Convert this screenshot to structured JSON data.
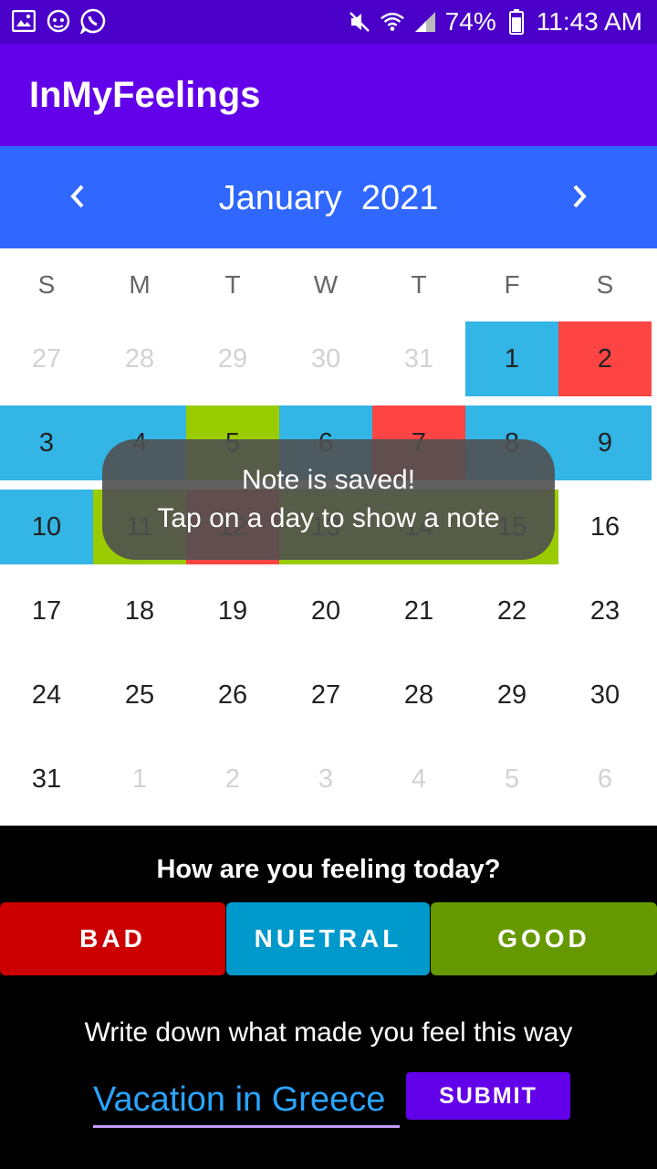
{
  "status_bar": {
    "battery": "74%",
    "time": "11:43 AM",
    "icons": [
      "image-icon",
      "face-icon",
      "whatsapp-icon",
      "mute-icon",
      "wifi-icon",
      "signal-icon",
      "battery-icon"
    ]
  },
  "app": {
    "title": "InMyFeelings"
  },
  "calendar": {
    "month": "January",
    "year": "2021",
    "prev_icon": "chevron-left-icon",
    "next_icon": "chevron-right-icon",
    "weekdays": [
      "S",
      "M",
      "T",
      "W",
      "T",
      "F",
      "S"
    ],
    "days": [
      {
        "n": "27",
        "faded": true,
        "mood": null
      },
      {
        "n": "28",
        "faded": true,
        "mood": null
      },
      {
        "n": "29",
        "faded": true,
        "mood": null
      },
      {
        "n": "30",
        "faded": true,
        "mood": null
      },
      {
        "n": "31",
        "faded": true,
        "mood": null
      },
      {
        "n": "1",
        "faded": false,
        "mood": "neutral"
      },
      {
        "n": "2",
        "faded": false,
        "mood": "bad"
      },
      {
        "n": "3",
        "faded": false,
        "mood": "neutral"
      },
      {
        "n": "4",
        "faded": false,
        "mood": "neutral"
      },
      {
        "n": "5",
        "faded": false,
        "mood": "good"
      },
      {
        "n": "6",
        "faded": false,
        "mood": "neutral"
      },
      {
        "n": "7",
        "faded": false,
        "mood": "bad"
      },
      {
        "n": "8",
        "faded": false,
        "mood": "neutral"
      },
      {
        "n": "9",
        "faded": false,
        "mood": "neutral"
      },
      {
        "n": "10",
        "faded": false,
        "mood": "neutral"
      },
      {
        "n": "11",
        "faded": false,
        "mood": "good"
      },
      {
        "n": "12",
        "faded": false,
        "mood": "bad"
      },
      {
        "n": "13",
        "faded": false,
        "mood": "good"
      },
      {
        "n": "14",
        "faded": false,
        "mood": "good"
      },
      {
        "n": "15",
        "faded": false,
        "mood": "good"
      },
      {
        "n": "16",
        "faded": false,
        "mood": null
      },
      {
        "n": "17",
        "faded": false,
        "mood": null
      },
      {
        "n": "18",
        "faded": false,
        "mood": null
      },
      {
        "n": "19",
        "faded": false,
        "mood": null
      },
      {
        "n": "20",
        "faded": false,
        "mood": null
      },
      {
        "n": "21",
        "faded": false,
        "mood": null
      },
      {
        "n": "22",
        "faded": false,
        "mood": null
      },
      {
        "n": "23",
        "faded": false,
        "mood": null
      },
      {
        "n": "24",
        "faded": false,
        "mood": null
      },
      {
        "n": "25",
        "faded": false,
        "mood": null
      },
      {
        "n": "26",
        "faded": false,
        "mood": null
      },
      {
        "n": "27",
        "faded": false,
        "mood": null
      },
      {
        "n": "28",
        "faded": false,
        "mood": null
      },
      {
        "n": "29",
        "faded": false,
        "mood": null
      },
      {
        "n": "30",
        "faded": false,
        "mood": null
      },
      {
        "n": "31",
        "faded": false,
        "mood": null
      },
      {
        "n": "1",
        "faded": true,
        "mood": null
      },
      {
        "n": "2",
        "faded": true,
        "mood": null
      },
      {
        "n": "3",
        "faded": true,
        "mood": null
      },
      {
        "n": "4",
        "faded": true,
        "mood": null
      },
      {
        "n": "5",
        "faded": true,
        "mood": null
      },
      {
        "n": "6",
        "faded": true,
        "mood": null
      }
    ]
  },
  "toast": {
    "line1": "Note is saved!",
    "line2": "Tap on a day to show a note"
  },
  "mood_section": {
    "question": "How are you feeling today?",
    "buttons": [
      {
        "label": "BAD",
        "color": "#cc0000"
      },
      {
        "label": "NUETRAL",
        "color": "#0099cc"
      },
      {
        "label": "GOOD",
        "color": "#669900"
      }
    ]
  },
  "note_section": {
    "prompt": "Write down what made you feel this way",
    "value": "Vacation in Greece",
    "submit_label": "SUBMIT"
  },
  "colors": {
    "statusbar": "#4a00c8",
    "appbar": "#6200ea",
    "month_header": "#2f67ff",
    "mood_bad": "#ff4444",
    "mood_neutral": "#33b5e5",
    "mood_good": "#99cc00"
  }
}
